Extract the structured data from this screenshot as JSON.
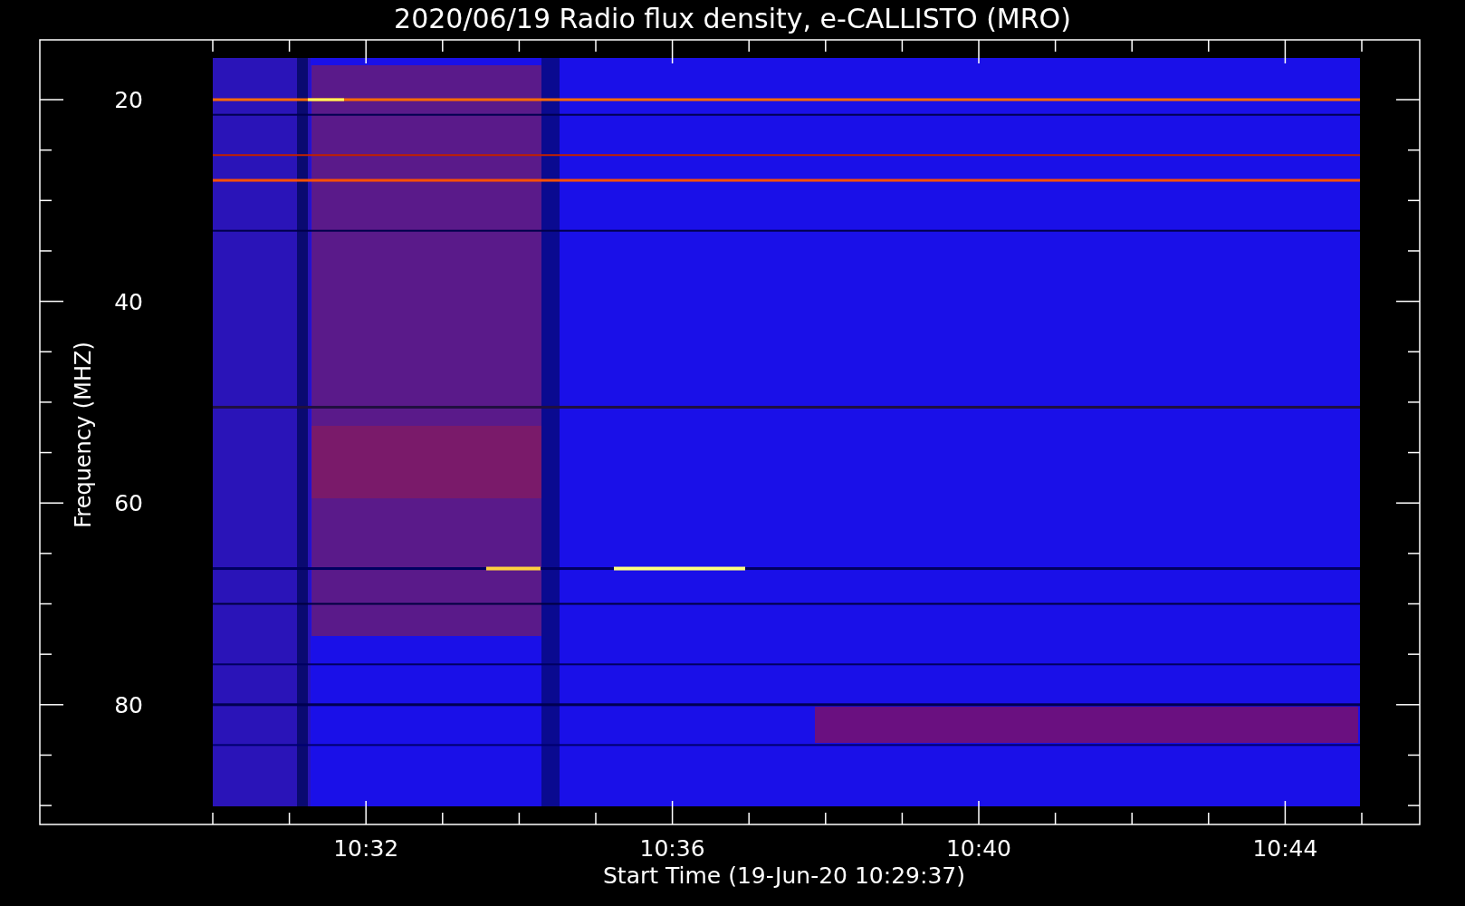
{
  "title": "2020/06/19  Radio flux density, e-CALLISTO (MRO)",
  "y_axis": {
    "label": "Frequency (MHZ)",
    "ticks": [
      "20",
      "40",
      "60",
      "80"
    ]
  },
  "x_axis": {
    "label": "Start Time (19-Jun-20 10:29:37)",
    "ticks": [
      "10:32",
      "10:36",
      "10:40",
      "10:44"
    ]
  }
}
